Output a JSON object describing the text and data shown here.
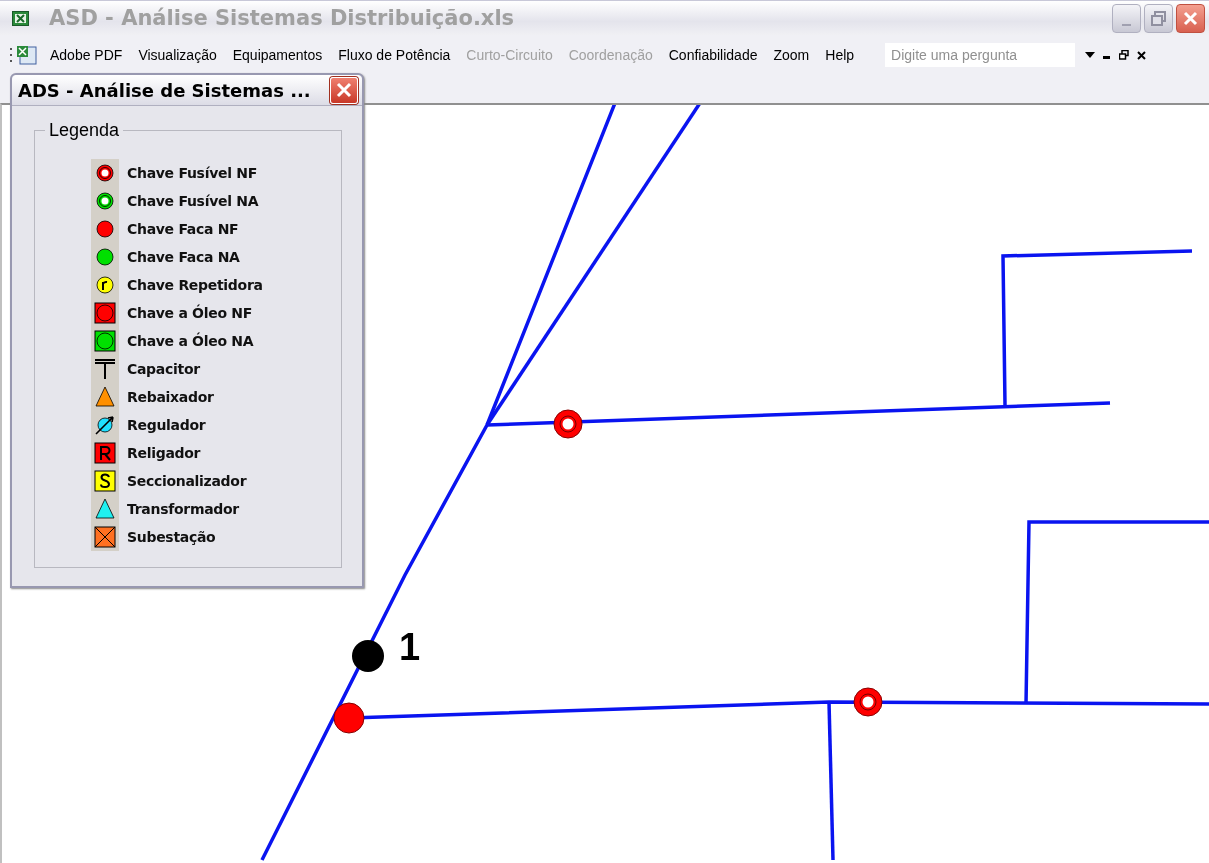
{
  "window": {
    "title": "ASD - Análise Sistemas Distribuição.xls"
  },
  "menu": [
    {
      "label": "Adobe PDF",
      "disabled": false
    },
    {
      "label": "Visualização",
      "disabled": false
    },
    {
      "label": "Equipamentos",
      "disabled": false
    },
    {
      "label": "Fluxo de Potência",
      "disabled": false
    },
    {
      "label": "Curto-Circuito",
      "disabled": true
    },
    {
      "label": "Coordenação",
      "disabled": true
    },
    {
      "label": "Confiabilidade",
      "disabled": false
    },
    {
      "label": "Zoom",
      "disabled": false
    },
    {
      "label": "Help",
      "disabled": false
    }
  ],
  "help_search": {
    "placeholder": "Digite uma pergunta"
  },
  "legend_window": {
    "title": "ADS - Análise de Sistemas ...",
    "group_title": "Legenda",
    "items": [
      {
        "kind": "fuse",
        "color": "#ff0000",
        "label": "Chave Fusível NF"
      },
      {
        "kind": "fuse",
        "color": "#00e000",
        "label": "Chave Fusível NA"
      },
      {
        "kind": "knife",
        "color": "#ff0000",
        "label": "Chave Faca NF"
      },
      {
        "kind": "knife",
        "color": "#00e000",
        "label": "Chave Faca NA"
      },
      {
        "kind": "repeater",
        "label": "Chave Repetidora"
      },
      {
        "kind": "oil",
        "color": "#ff0000",
        "label": "Chave a Óleo NF"
      },
      {
        "kind": "oil",
        "color": "#00e000",
        "label": "Chave a Óleo NA"
      },
      {
        "kind": "capacitor",
        "label": "Capacitor"
      },
      {
        "kind": "stepdown",
        "label": "Rebaixador"
      },
      {
        "kind": "regulator",
        "label": "Regulador"
      },
      {
        "kind": "recloser",
        "label": "Religador"
      },
      {
        "kind": "sectionalizer",
        "label": "Seccionalizador"
      },
      {
        "kind": "transformer",
        "label": "Transformador"
      },
      {
        "kind": "substation",
        "label": "Subestação"
      }
    ]
  },
  "diagram": {
    "node_label": "1"
  }
}
